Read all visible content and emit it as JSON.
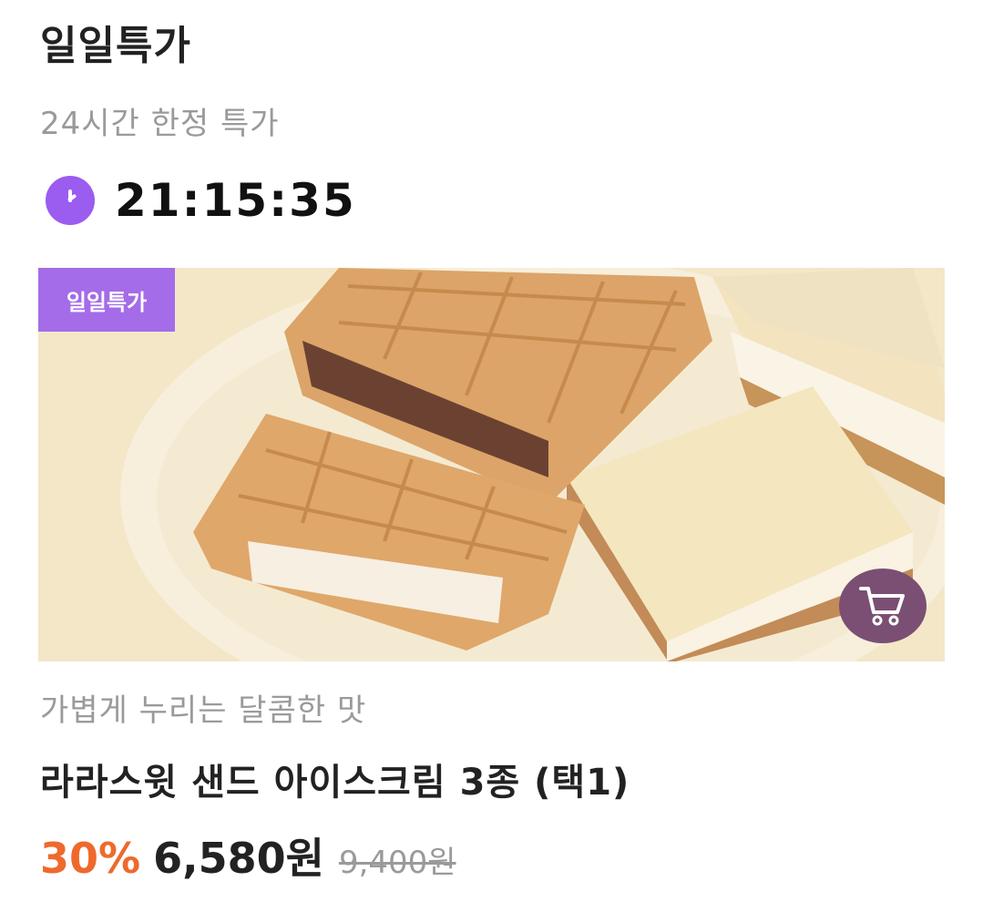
{
  "header": {
    "title": "일일특가",
    "subtitle": "24시간 한정 특가",
    "timer": "21:15:35"
  },
  "product": {
    "tag": "일일특가",
    "description": "가볍게 누리는 달콤한 맛",
    "name": "라라스윗 샌드 아이스크림 3종 (택1)",
    "discount": "30%",
    "price": "6,580원",
    "original_price": "9,400원"
  },
  "icons": {
    "clock": "clock-icon",
    "cart": "cart-icon"
  },
  "colors": {
    "accent_purple": "#9b5cf0",
    "tag_purple": "#a46ce8",
    "discount_orange": "#ee6a2c",
    "cart_button": "#7a4f73"
  }
}
